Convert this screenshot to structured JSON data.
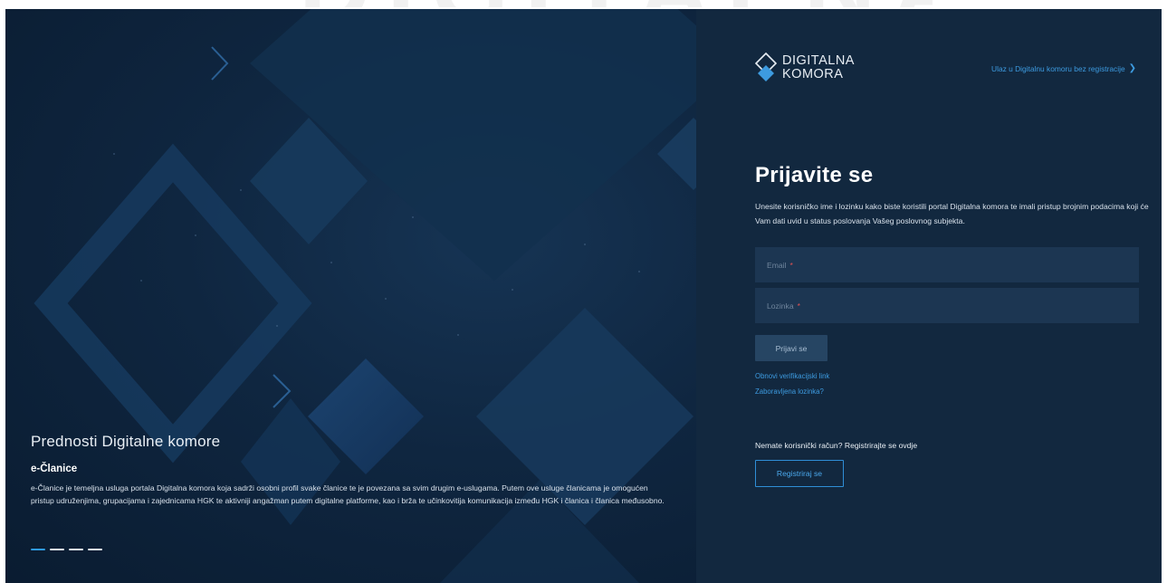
{
  "watermark": "DIGITALNA",
  "hero": {
    "heading": "Prednosti Digitalne komore",
    "subheading": "e-Članice",
    "description": "e-Članice je temeljna usluga portala Digitalna komora koja sadrži osobni profil svake članice te je povezana sa svim drugim e-uslugama. Putem ove usluge članicama je omogućen pristup udruženjima, grupacijama i zajednicama HGK te aktivniji angažman putem digitalne platforme, kao i brža te učinkovitija komunikacija između HGK i članica i članica međusobno.",
    "slides": 4,
    "active_slide": 1
  },
  "header": {
    "logo_line1": "DIGITALNA",
    "logo_line2": "KOMORA",
    "guest_link": "Ulaz u Digitalnu komoru bez registracije"
  },
  "login": {
    "title": "Prijavite se",
    "description": "Unesite korisničko ime i lozinku kako biste koristili portal Digitalna komora te imali pristup brojnim podacima koji će Vam dati uvid u status poslovanja Vašeg poslovnog subjekta.",
    "email_placeholder": "Email",
    "password_placeholder": "Lozinka",
    "required_mark": "*",
    "submit_label": "Prijavi se",
    "reverify_link": "Obnovi verifikacijski link",
    "forgot_link": "Zaboravljena lozinka?"
  },
  "register": {
    "prompt": "Nemate korisnički račun? Registrirajte se ovdje",
    "button_label": "Registriraj se"
  },
  "colors": {
    "panel_bg": "#12283f",
    "hero_bg": "#0f2640",
    "accent": "#3d9be0",
    "input_bg": "#1c3652",
    "required": "#e55353"
  }
}
